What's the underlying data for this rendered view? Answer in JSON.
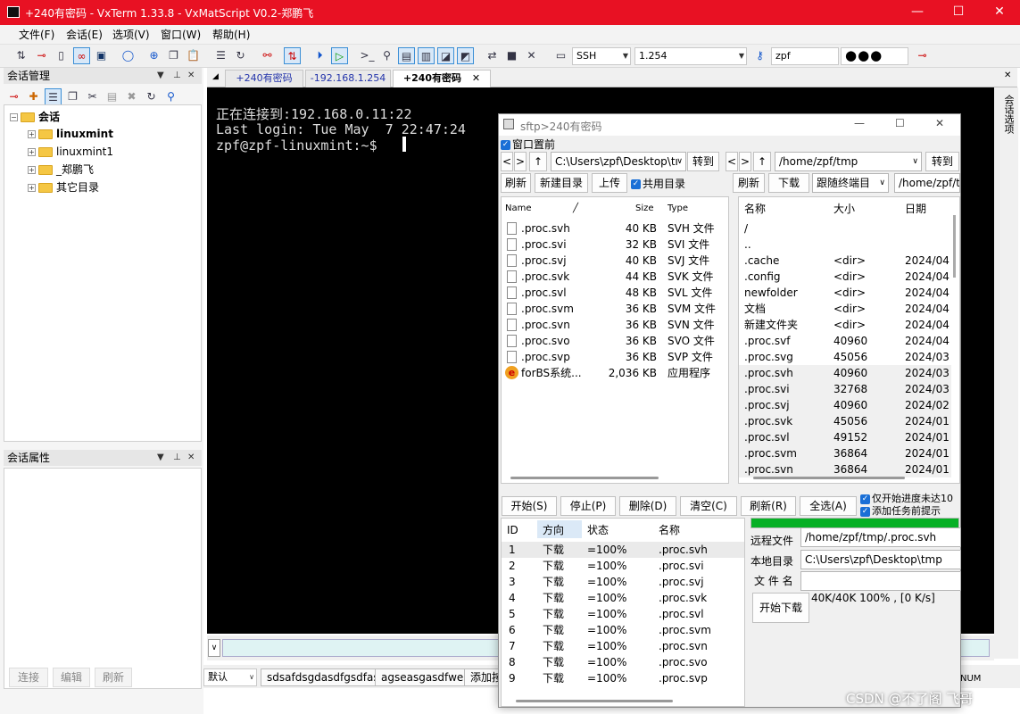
{
  "app": {
    "title": "+240有密码 - VxTerm 1.33.8 - VxMatScript V0.2-郑鹏飞"
  },
  "window_controls": {
    "minimize": "—",
    "maximize": "☐",
    "close": "✕"
  },
  "menu": [
    "文件(F)",
    "会话(E)",
    "选项(V)",
    "窗口(W)",
    "帮助(H)"
  ],
  "toolbar": {
    "protocol": "SSH",
    "host": "1.254",
    "user": "zpf",
    "password_mask": "●●●"
  },
  "session_panel": {
    "title": "会话管理",
    "tree": {
      "root": "会话",
      "items": [
        "linuxmint",
        "linuxmint1",
        "_郑鹏飞",
        "其它目录"
      ]
    }
  },
  "props_panel": {
    "title": "会话属性",
    "buttons": [
      "连接",
      "编辑",
      "刷新"
    ]
  },
  "tabs": [
    "+240有密码",
    "-192.168.1.254",
    "+240有密码"
  ],
  "right_strip_label": "会话选项",
  "terminal": {
    "lines": [
      "正在连接到:192.168.0.11:22",
      "Last login: Tue May  7 22:47:24",
      "zpf@zpf-linuxmint:~$ "
    ]
  },
  "command_bar": {
    "select": "默认",
    "buttons": [
      "sdsafdsgdasdfgsdfasd",
      "agseasgasdfwe",
      "添加按"
    ]
  },
  "sftp": {
    "title": "sftp>240有密码",
    "pin_label": "窗口置前",
    "local": {
      "path": "C:\\Users\\zpf\\Desktop\\tı",
      "go": "转到",
      "refresh": "刷新",
      "newdir": "新建目录",
      "upload": "上传",
      "shared": "共用目录",
      "headers": [
        "Name",
        "Size",
        "Type"
      ],
      "files": [
        {
          "name": ".proc.svh",
          "size": "40 KB",
          "type": "SVH 文件"
        },
        {
          "name": ".proc.svi",
          "size": "32 KB",
          "type": "SVI 文件"
        },
        {
          "name": ".proc.svj",
          "size": "40 KB",
          "type": "SVJ 文件"
        },
        {
          "name": ".proc.svk",
          "size": "44 KB",
          "type": "SVK 文件"
        },
        {
          "name": ".proc.svl",
          "size": "48 KB",
          "type": "SVL 文件"
        },
        {
          "name": ".proc.svm",
          "size": "36 KB",
          "type": "SVM 文件"
        },
        {
          "name": ".proc.svn",
          "size": "36 KB",
          "type": "SVN 文件"
        },
        {
          "name": ".proc.svo",
          "size": "36 KB",
          "type": "SVO 文件"
        },
        {
          "name": ".proc.svp",
          "size": "36 KB",
          "type": "SVP 文件"
        },
        {
          "name": "forBS系统...",
          "size": "2,036 KB",
          "type": "应用程序"
        }
      ]
    },
    "remote": {
      "path": "/home/zpf/tmp",
      "go": "转到",
      "refresh": "刷新",
      "download": "下载",
      "follow": "跟随终端目",
      "path2": "/home/zpf/tı",
      "headers": [
        "名称",
        "大小",
        "日期"
      ],
      "files": [
        {
          "name": "/",
          "size": "",
          "date": ""
        },
        {
          "name": "..",
          "size": "",
          "date": ""
        },
        {
          "name": ".cache",
          "size": "<dir>",
          "date": "2024/04"
        },
        {
          "name": ".config",
          "size": "<dir>",
          "date": "2024/04"
        },
        {
          "name": "newfolder",
          "size": "<dir>",
          "date": "2024/04"
        },
        {
          "name": "文档",
          "size": "<dir>",
          "date": "2024/04"
        },
        {
          "name": "新建文件夹",
          "size": "<dir>",
          "date": "2024/04"
        },
        {
          "name": ".proc.svf",
          "size": "40960",
          "date": "2024/04"
        },
        {
          "name": ".proc.svg",
          "size": "45056",
          "date": "2024/03"
        },
        {
          "name": ".proc.svh",
          "size": "40960",
          "date": "2024/03"
        },
        {
          "name": ".proc.svi",
          "size": "32768",
          "date": "2024/03"
        },
        {
          "name": ".proc.svj",
          "size": "40960",
          "date": "2024/02"
        },
        {
          "name": ".proc.svk",
          "size": "45056",
          "date": "2024/01"
        },
        {
          "name": ".proc.svl",
          "size": "49152",
          "date": "2024/01"
        },
        {
          "name": ".proc.svm",
          "size": "36864",
          "date": "2024/01"
        },
        {
          "name": ".proc.svn",
          "size": "36864",
          "date": "2024/01"
        }
      ]
    },
    "actions": [
      "开始(S)",
      "停止(P)",
      "删除(D)",
      "清空(C)",
      "刷新(R)",
      "全选(A)"
    ],
    "opt1": "仅开始进度未达10",
    "opt2": "添加任务前提示",
    "queue": {
      "headers": [
        "ID",
        "方向",
        "状态",
        "名称"
      ],
      "rows": [
        {
          "id": "1",
          "dir": "下载",
          "status": "=100%",
          "name": ".proc.svh"
        },
        {
          "id": "2",
          "dir": "下载",
          "status": "=100%",
          "name": ".proc.svi"
        },
        {
          "id": "3",
          "dir": "下载",
          "status": "=100%",
          "name": ".proc.svj"
        },
        {
          "id": "4",
          "dir": "下载",
          "status": "=100%",
          "name": ".proc.svk"
        },
        {
          "id": "5",
          "dir": "下载",
          "status": "=100%",
          "name": ".proc.svl"
        },
        {
          "id": "6",
          "dir": "下载",
          "status": "=100%",
          "name": ".proc.svm"
        },
        {
          "id": "7",
          "dir": "下载",
          "status": "=100%",
          "name": ".proc.svn"
        },
        {
          "id": "8",
          "dir": "下载",
          "status": "=100%",
          "name": ".proc.svo"
        },
        {
          "id": "9",
          "dir": "下载",
          "status": "=100%",
          "name": ".proc.svp"
        }
      ]
    },
    "detail": {
      "remote_label": "远程文件",
      "remote_value": "/home/zpf/tmp/.proc.svh",
      "local_label": "本地目录",
      "local_value": "C:\\Users\\zpf\\Desktop\\tmp",
      "filename_label": "文 件 名",
      "filename_value": "",
      "start_download": "开始下载",
      "progress_text": "40K/40K 100% , [0 K/s]",
      "progress": 1.0
    }
  },
  "status_right": "NUM",
  "watermark": "CSDN @不了阁 飞哥",
  "colors": {
    "titlebar": "#e81123",
    "progress": "#06b025",
    "terminal_bg": "#000000"
  }
}
